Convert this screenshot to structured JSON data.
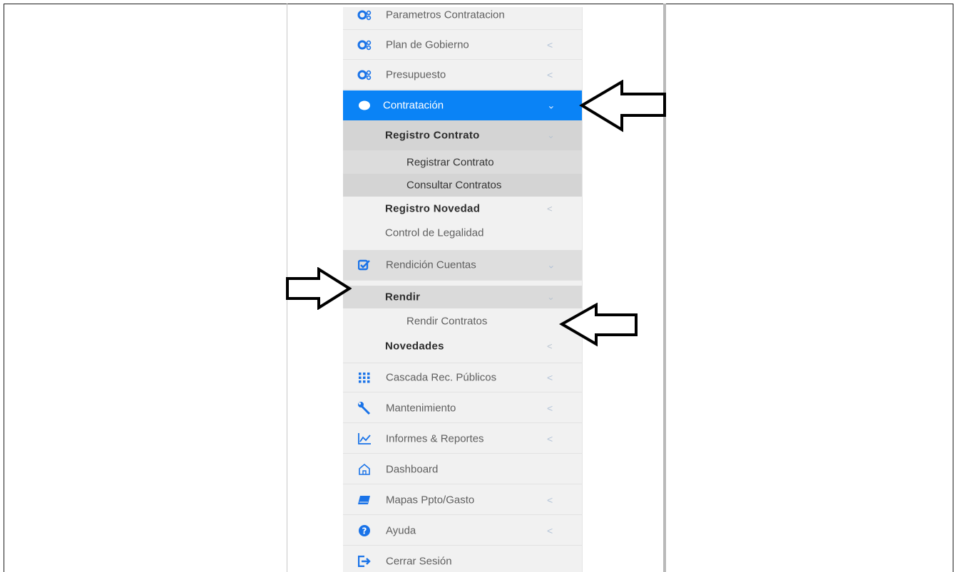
{
  "menu": {
    "top_partial": {
      "label": "Parametros Contratacion",
      "icon": "cogs-icon"
    },
    "items_top": [
      {
        "label": "Plan de Gobierno",
        "icon": "cogs-icon",
        "chevron": "<"
      },
      {
        "label": "Presupuesto",
        "icon": "cogs-icon",
        "chevron": "<"
      }
    ],
    "active": {
      "label": "Contratación",
      "icon": "circle-icon",
      "chevron": "⌄"
    },
    "contratacion_sub": {
      "registro_contrato": {
        "label": "Registro Contrato",
        "chevron": "⌄"
      },
      "registrar_contrato": "Registrar Contrato",
      "consultar_contratos": "Consultar Contratos",
      "registro_novedad": {
        "label": "Registro Novedad",
        "chevron": "<"
      },
      "control_legalidad": "Control de Legalidad"
    },
    "rendicion": {
      "label": "Rendición Cuentas",
      "icon": "check-edit-icon",
      "chevron": "⌄"
    },
    "rendicion_sub": {
      "rendir": {
        "label": "Rendir",
        "chevron": "⌄"
      },
      "rendir_contratos": "Rendir Contratos",
      "novedades": {
        "label": "Novedades",
        "chevron": "<"
      }
    },
    "items_bottom": [
      {
        "label": "Cascada Rec. Públicos",
        "icon": "grid-dots-icon",
        "chevron": "<"
      },
      {
        "label": "Mantenimiento",
        "icon": "wrench-icon",
        "chevron": "<"
      },
      {
        "label": "Informes & Reportes",
        "icon": "line-chart-icon",
        "chevron": "<"
      },
      {
        "label": "Dashboard",
        "icon": "home-icon",
        "chevron": ""
      },
      {
        "label": "Mapas Ppto/Gasto",
        "icon": "book-icon",
        "chevron": "<"
      },
      {
        "label": "Ayuda",
        "icon": "question-circle-icon",
        "chevron": "<"
      },
      {
        "label": "Cerrar Sesión",
        "icon": "sign-out-icon",
        "chevron": ""
      }
    ]
  },
  "colors": {
    "accent": "#0a83f6",
    "icon_blue": "#1a73e8",
    "sidebar_bg": "#f1f1f1"
  }
}
